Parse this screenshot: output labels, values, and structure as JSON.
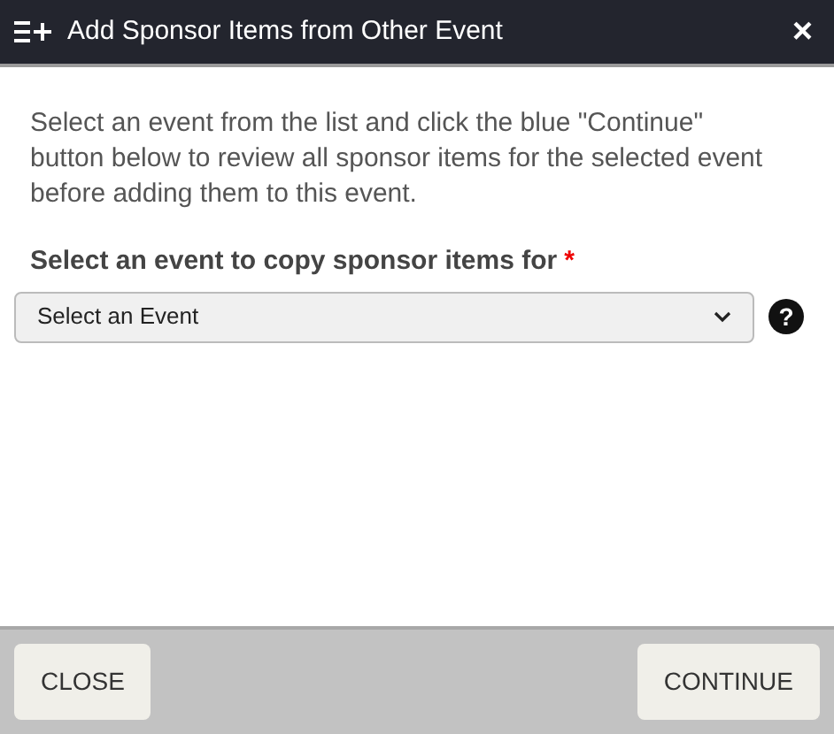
{
  "dialog": {
    "title": "Add Sponsor Items from Other Event",
    "close_icon_label": "×"
  },
  "instructions": "Select an event from the list and click the blue \"Continue\" button below to review all sponsor items for the selected event before adding them to this event.",
  "field": {
    "label": "Select an event to copy sponsor items for",
    "required": true,
    "required_mark": "*",
    "value": "Select an Event",
    "help_icon": "?"
  },
  "buttons": [
    {
      "label": "CLOSE"
    },
    {
      "label": "CONTINUE"
    }
  ]
}
